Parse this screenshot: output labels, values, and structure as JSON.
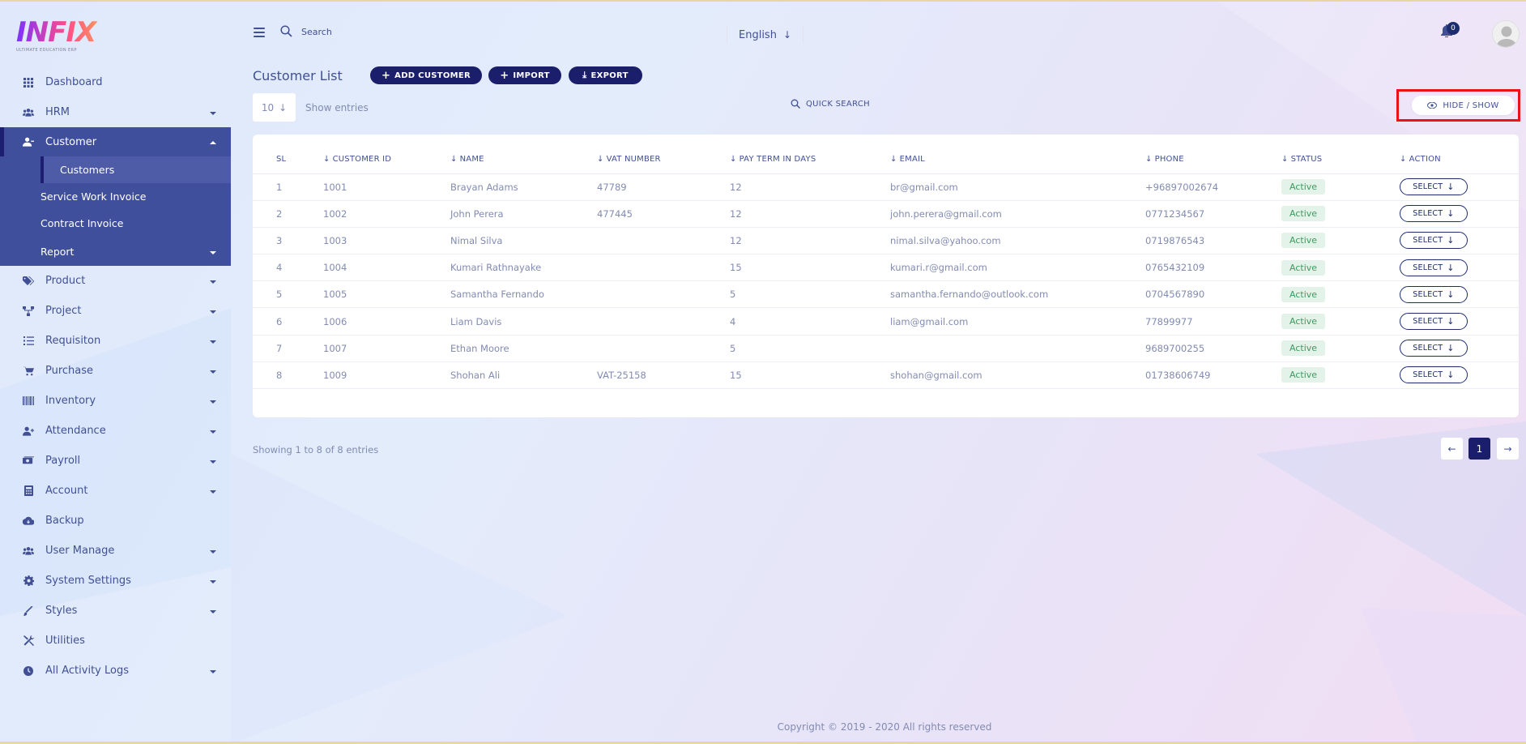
{
  "logo": {
    "text": "INFIX",
    "subtitle": "ULTIMATE EDUCATION ERP"
  },
  "sidebar": {
    "items_top": [
      {
        "label": "Dashboard",
        "icon": "grid-icon",
        "caret": false
      },
      {
        "label": "HRM",
        "icon": "users-icon",
        "caret": true
      }
    ],
    "group": {
      "label": "Customer",
      "icon": "user-icon",
      "sub": [
        {
          "label": "Customers",
          "active": true
        },
        {
          "label": "Service Work Invoice"
        },
        {
          "label": "Contract Invoice"
        },
        {
          "label": "Report",
          "caret": true
        }
      ]
    },
    "items_bottom": [
      {
        "label": "Product",
        "icon": "tag-icon",
        "caret": true
      },
      {
        "label": "Project",
        "icon": "project-icon",
        "caret": true
      },
      {
        "label": "Requisiton",
        "icon": "list-icon",
        "caret": true
      },
      {
        "label": "Purchase",
        "icon": "cart-icon",
        "caret": true
      },
      {
        "label": "Inventory",
        "icon": "barcode-icon",
        "caret": true
      },
      {
        "label": "Attendance",
        "icon": "user-plus-icon",
        "caret": true
      },
      {
        "label": "Payroll",
        "icon": "money-icon",
        "caret": true
      },
      {
        "label": "Account",
        "icon": "calculator-icon",
        "caret": true
      },
      {
        "label": "Backup",
        "icon": "cloud-icon",
        "caret": false
      },
      {
        "label": "User Manage",
        "icon": "users-icon",
        "caret": true
      },
      {
        "label": "System Settings",
        "icon": "gear-icon",
        "caret": true
      },
      {
        "label": "Styles",
        "icon": "brush-icon",
        "caret": true
      },
      {
        "label": "Utilities",
        "icon": "tools-icon",
        "caret": false
      },
      {
        "label": "All Activity Logs",
        "icon": "clock-icon",
        "caret": true
      }
    ]
  },
  "header": {
    "search_label": "Search",
    "language": "English",
    "notification_count": "0"
  },
  "page": {
    "title": "Customer List",
    "add_label": "ADD CUSTOMER",
    "import_label": "IMPORT",
    "export_label": "EXPORT",
    "entries_value": "10",
    "entries_label": "Show entries",
    "quick_search": "QUICK SEARCH",
    "hide_show": "HIDE / SHOW"
  },
  "table": {
    "columns": [
      "SL",
      "CUSTOMER ID",
      "NAME",
      "VAT NUMBER",
      "PAY TERM IN DAYS",
      "EMAIL",
      "PHONE",
      "STATUS",
      "ACTION"
    ],
    "rows": [
      [
        "1",
        "1001",
        "Brayan Adams",
        "47789",
        "12",
        "br@gmail.com",
        "+96897002674",
        "Active",
        "SELECT"
      ],
      [
        "2",
        "1002",
        "John Perera",
        "477445",
        "12",
        "john.perera@gmail.com",
        "0771234567",
        "Active",
        "SELECT"
      ],
      [
        "3",
        "1003",
        "Nimal Silva",
        "",
        "12",
        "nimal.silva@yahoo.com",
        "0719876543",
        "Active",
        "SELECT"
      ],
      [
        "4",
        "1004",
        "Kumari Rathnayake",
        "",
        "15",
        "kumari.r@gmail.com",
        "0765432109",
        "Active",
        "SELECT"
      ],
      [
        "5",
        "1005",
        "Samantha Fernando",
        "",
        "5",
        "samantha.fernando@outlook.com",
        "0704567890",
        "Active",
        "SELECT"
      ],
      [
        "6",
        "1006",
        "Liam Davis",
        "",
        "4",
        "liam@gmail.com",
        "77899977",
        "Active",
        "SELECT"
      ],
      [
        "7",
        "1007",
        "Ethan Moore",
        "",
        "5",
        "",
        "9689700255",
        "Active",
        "SELECT"
      ],
      [
        "8",
        "1009",
        "Shohan Ali",
        "VAT-25158",
        "15",
        "shohan@gmail.com",
        "01738606749",
        "Active",
        "SELECT"
      ]
    ],
    "showing": "Showing 1 to 8 of 8 entries",
    "current_page": "1"
  },
  "footer": {
    "copyright": "Copyright © 2019 - 2020 All rights reserved"
  },
  "colors": {
    "accent": "#1b1e6b",
    "sidebar_active": "#3f4f9c",
    "text": "#415094",
    "muted": "#828bb2",
    "highlight": "#e8141a"
  }
}
